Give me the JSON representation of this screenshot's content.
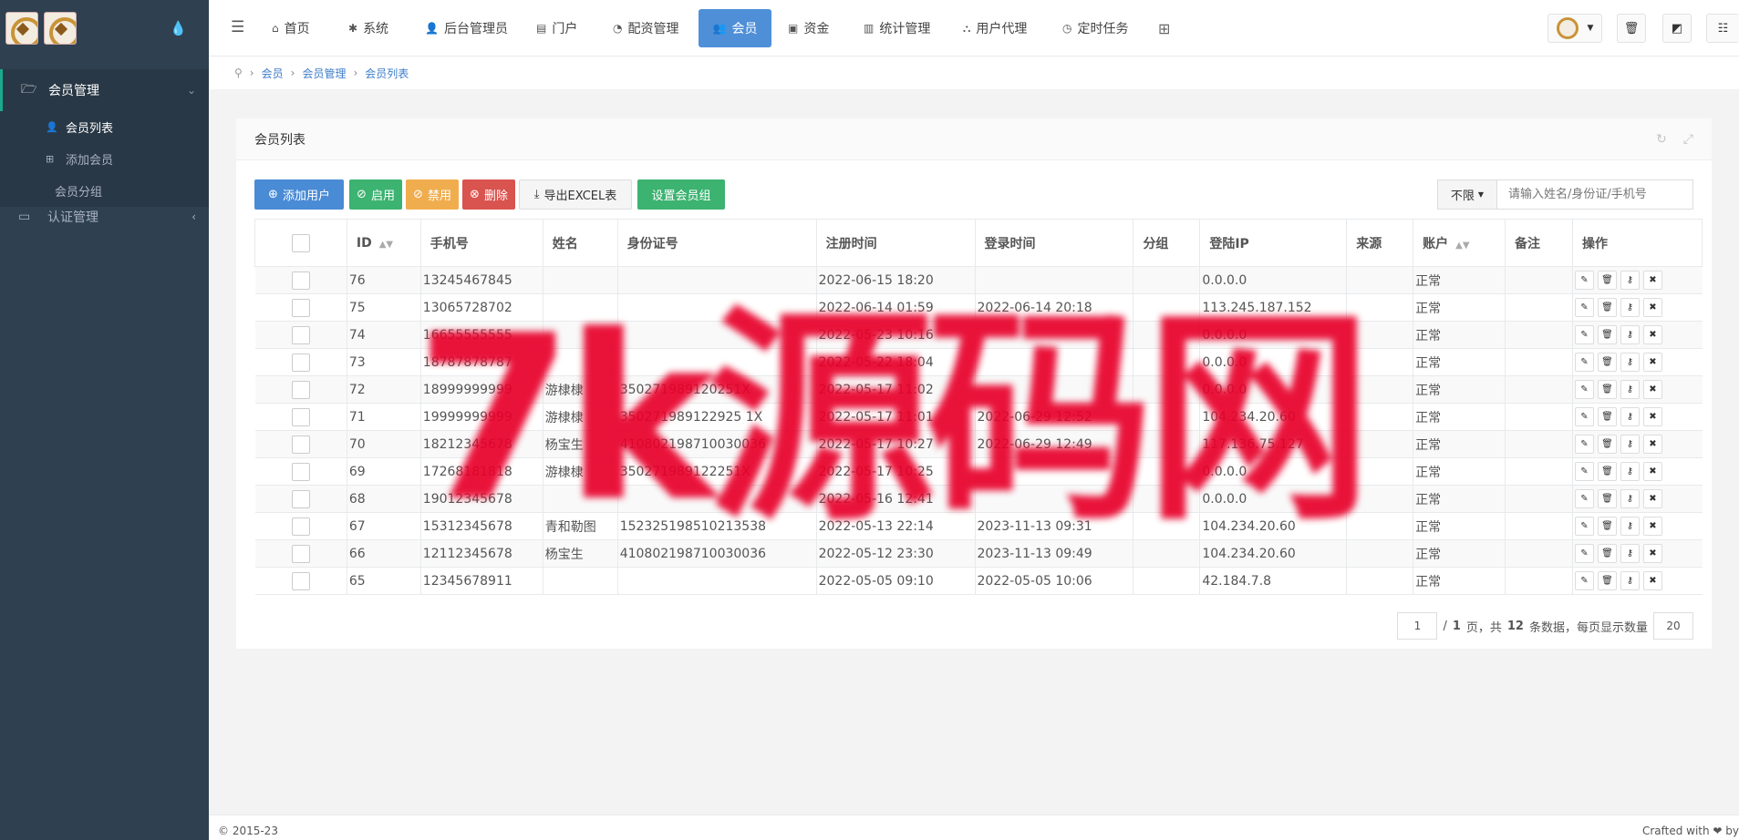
{
  "sidebar": {
    "groups": [
      {
        "label": "会员管理",
        "icon": "folder-open-icon",
        "expanded": true,
        "items": [
          {
            "label": "会员列表",
            "icon": "user-icon",
            "active": true
          },
          {
            "label": "添加会员",
            "icon": "plus-square-icon"
          },
          {
            "label": "会员分组",
            "icon": ""
          }
        ]
      },
      {
        "label": "认证管理",
        "icon": "id-card-icon",
        "expanded": false
      }
    ]
  },
  "topnav": {
    "items": [
      {
        "label": "首页",
        "icon": "home-icon"
      },
      {
        "label": "系统",
        "icon": "gear-icon"
      },
      {
        "label": "后台管理员",
        "icon": "user-icon"
      },
      {
        "label": "门户",
        "icon": "list-alt-icon"
      },
      {
        "label": "配资管理",
        "icon": "pie-chart-icon"
      },
      {
        "label": "会员",
        "icon": "users-icon",
        "active": true
      },
      {
        "label": "资金",
        "icon": "money-icon"
      },
      {
        "label": "统计管理",
        "icon": "bar-chart-icon"
      },
      {
        "label": "用户代理",
        "icon": "sitemap-icon"
      },
      {
        "label": "定时任务",
        "icon": "clock-icon"
      }
    ]
  },
  "breadcrumb": [
    "会员",
    "会员管理",
    "会员列表"
  ],
  "panel": {
    "title": "会员列表",
    "toolbar": {
      "add": "添加用户",
      "enable": "启用",
      "disable": "禁用",
      "delete": "删除",
      "export": "导出EXCEL表",
      "set_group": "设置会员组"
    },
    "filter": {
      "select": "不限",
      "search_placeholder": "请输入姓名/身份证/手机号"
    }
  },
  "table": {
    "headers": [
      "ID",
      "手机号",
      "姓名",
      "身份证号",
      "注册时间",
      "登录时间",
      "分组",
      "登陆IP",
      "来源",
      "账户",
      "备注",
      "操作"
    ],
    "rows": [
      [
        "76",
        "13245467845",
        "",
        "",
        "2022-06-15 18:20",
        "",
        "",
        "0.0.0.0",
        "",
        "正常",
        ""
      ],
      [
        "75",
        "13065728702",
        "",
        "",
        "2022-06-14 01:59",
        "2022-06-14 20:18",
        "",
        "113.245.187.152",
        "",
        "正常",
        ""
      ],
      [
        "74",
        "16655555555",
        "",
        "",
        "2022-05-23 10:16",
        "",
        "",
        "0.0.0.0",
        "",
        "正常",
        ""
      ],
      [
        "73",
        "18787878787",
        "",
        "",
        "2022-05-22 18:04",
        "",
        "",
        "0.0.0.0",
        "",
        "正常",
        ""
      ],
      [
        "72",
        "18999999999",
        "游棣棣",
        "350271989120251X",
        "2022-05-17 11:02",
        "",
        "",
        "0.0.0.0",
        "",
        "正常",
        ""
      ],
      [
        "71",
        "19999999999",
        "游棣棣",
        "350271989122925 1X",
        "2022-05-17 11:01",
        "2022-06-29 12:52",
        "",
        "104.234.20.60",
        "",
        "正常",
        ""
      ],
      [
        "70",
        "18212345678",
        "杨宝生",
        "410802198710030036",
        "2022-05-17 10:27",
        "2022-06-29 12:49",
        "",
        "117.136.75.127",
        "",
        "正常",
        ""
      ],
      [
        "69",
        "17268181818",
        "游棣棣",
        "350271989122251X",
        "2022-05-17 10:25",
        "",
        "",
        "0.0.0.0",
        "",
        "正常",
        ""
      ],
      [
        "68",
        "19012345678",
        "",
        "",
        "2022-05-16 12:41",
        "",
        "",
        "0.0.0.0",
        "",
        "正常",
        ""
      ],
      [
        "67",
        "15312345678",
        "青和勒图",
        "152325198510213538",
        "2022-05-13 22:14",
        "2023-11-13 09:31",
        "",
        "104.234.20.60",
        "",
        "正常",
        ""
      ],
      [
        "66",
        "12112345678",
        "杨宝生",
        "410802198710030036",
        "2022-05-12 23:30",
        "2023-11-13 09:49",
        "",
        "104.234.20.60",
        "",
        "正常",
        ""
      ],
      [
        "65",
        "12345678911",
        "",
        "",
        "2022-05-05 09:10",
        "2022-05-05 10:06",
        "",
        "42.184.7.8",
        "",
        "正常",
        ""
      ]
    ]
  },
  "pager": {
    "page": "1",
    "sep": "/",
    "total_pages": "1",
    "page_word": "页，共",
    "total": "12",
    "tail": "条数据，每页显示数量",
    "per_page": "20"
  },
  "footer": {
    "left": "© 2015-23",
    "right": "Crafted with ❤ by"
  },
  "watermark": "7k源码网",
  "colors": {
    "sidebar": "#2f4050",
    "primary": "#4f8fd8",
    "success": "#3cb371",
    "warning": "#f0ad4e",
    "danger": "#d9534f"
  }
}
